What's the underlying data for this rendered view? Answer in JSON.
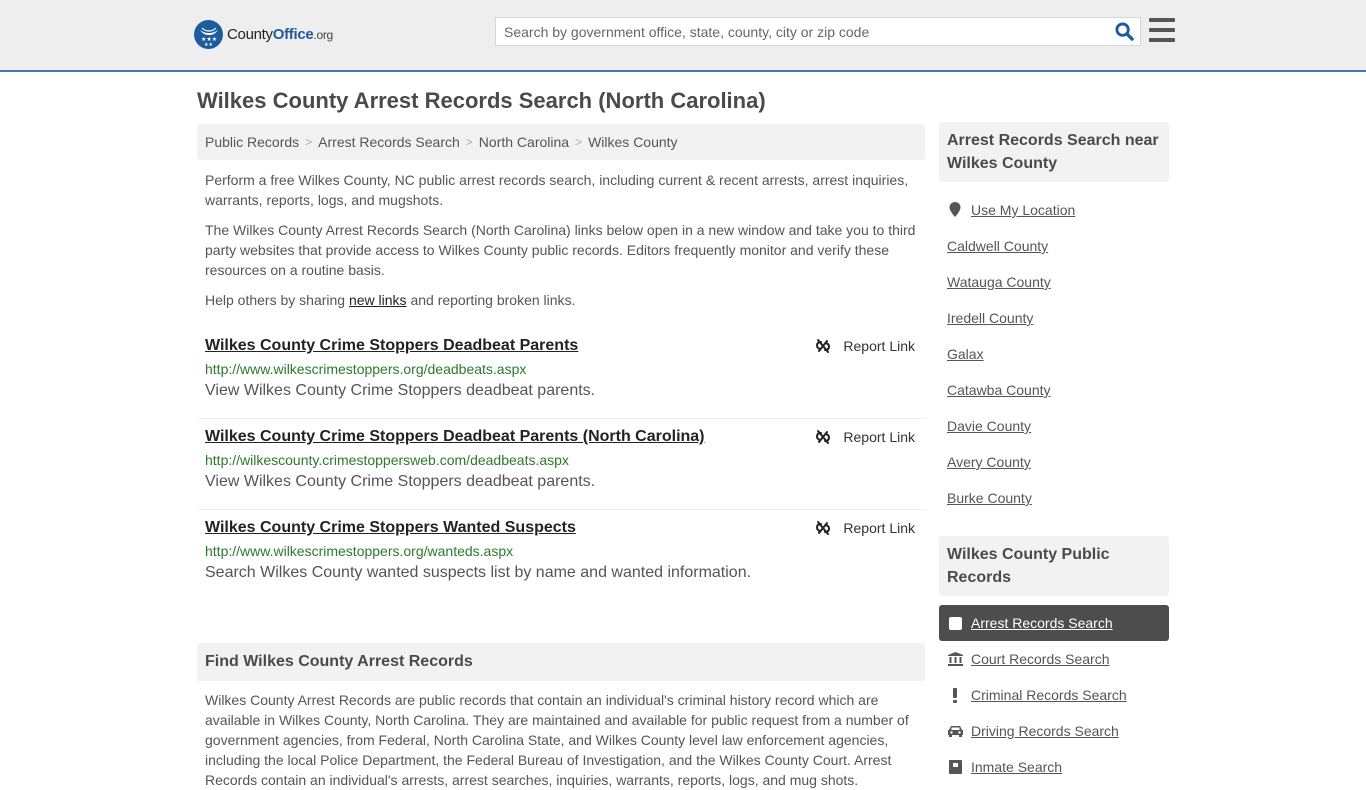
{
  "header": {
    "logo": {
      "name_part1": "County",
      "name_part2": "Office",
      "name_part3": ".org"
    },
    "search": {
      "placeholder": "Search by government office, state, county, city or zip code",
      "value": ""
    },
    "colors": {
      "brand": "#1d5a9e",
      "header_border": "#3a7bb0"
    }
  },
  "page": {
    "title": "Wilkes County Arrest Records Search (North Carolina)"
  },
  "breadcrumb": [
    {
      "label": "Public Records"
    },
    {
      "label": "Arrest Records Search"
    },
    {
      "label": "North Carolina"
    },
    {
      "label": "Wilkes County"
    }
  ],
  "intro": {
    "p1": "Perform a free Wilkes County, NC public arrest records search, including current & recent arrests, arrest inquiries, warrants, reports, logs, and mugshots.",
    "p2": "The Wilkes County Arrest Records Search (North Carolina) links below open in a new window and take you to third party websites that provide access to Wilkes County public records. Editors frequently monitor and verify these resources on a routine basis.",
    "p3_before": "Help others by sharing ",
    "p3_link": "new links",
    "p3_after": " and reporting broken links."
  },
  "results": [
    {
      "title": "Wilkes County Crime Stoppers Deadbeat Parents",
      "url": "http://www.wilkescrimestoppers.org/deadbeats.aspx",
      "description": "View Wilkes County Crime Stoppers deadbeat parents.",
      "report_label": "Report Link"
    },
    {
      "title": "Wilkes County Crime Stoppers Deadbeat Parents (North Carolina)",
      "url": "http://wilkescounty.crimestoppersweb.com/deadbeats.aspx",
      "description": "View Wilkes County Crime Stoppers deadbeat parents.",
      "report_label": "Report Link"
    },
    {
      "title": "Wilkes County Crime Stoppers Wanted Suspects",
      "url": "http://www.wilkescrimestoppers.org/wanteds.aspx",
      "description": "Search Wilkes County wanted suspects list by name and wanted information.",
      "report_label": "Report Link"
    }
  ],
  "find": {
    "title": "Find Wilkes County Arrest Records",
    "body": "Wilkes County Arrest Records are public records that contain an individual's criminal history record which are available in Wilkes County, North Carolina. They are maintained and available for public request from a number of government agencies, from Federal, North Carolina State, and Wilkes County level law enforcement agencies, including the local Police Department, the Federal Bureau of Investigation, and the Wilkes County Court. Arrest Records contain an individual's arrests, arrest searches, inquiries, warrants, reports, logs, and mug shots."
  },
  "sidebar": {
    "nearby": {
      "title": "Arrest Records Search near Wilkes County",
      "use_location": "Use My Location",
      "items": [
        "Caldwell County",
        "Watauga County",
        "Iredell County",
        "Galax",
        "Catawba County",
        "Davie County",
        "Avery County",
        "Burke County"
      ]
    },
    "public_records": {
      "title": "Wilkes County Public Records",
      "items": [
        {
          "label": "Arrest Records Search",
          "icon": "square-icon",
          "active": true
        },
        {
          "label": "Court Records Search",
          "icon": "courthouse-icon",
          "active": false
        },
        {
          "label": "Criminal Records Search",
          "icon": "exclamation-icon",
          "active": false
        },
        {
          "label": "Driving Records Search",
          "icon": "car-icon",
          "active": false
        },
        {
          "label": "Inmate Search",
          "icon": "inmate-icon",
          "active": false
        }
      ]
    }
  }
}
